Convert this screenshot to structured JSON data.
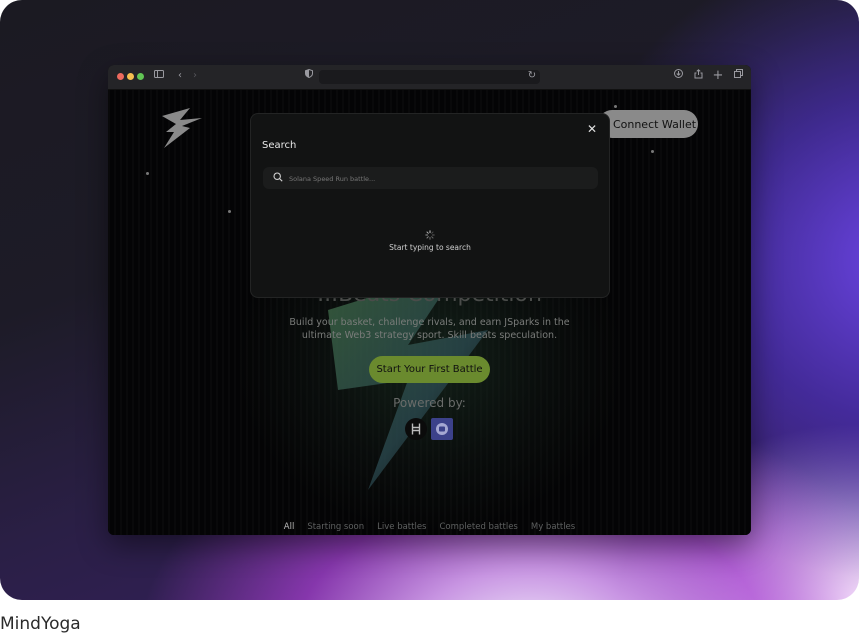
{
  "caption": "MindYoga",
  "browser": {
    "traffic_light_colors": [
      "#ed6a5e",
      "#f5bf4f",
      "#61c554"
    ],
    "icons": [
      "sidebar-icon",
      "back-icon",
      "forward-icon",
      "shield-icon",
      "reload-icon",
      "download-icon",
      "share-icon",
      "new-tab-icon",
      "tabs-icon"
    ]
  },
  "site": {
    "connect_wallet_label": "Connect Wallet",
    "hero_title": "...Beats Competition",
    "hero_subtitle": "Build your basket, challenge rivals, and earn JSparks in the ultimate Web3 strategy sport. Skill beats speculation.",
    "cta_label": "Start Your First Battle",
    "powered_by": "Powered by:",
    "partners": [
      "hedera-logo",
      "partner-logo"
    ],
    "filters": [
      "All",
      "Starting soon",
      "Live battles",
      "Completed battles",
      "My battles"
    ],
    "active_filter": "All",
    "accent_color": "#6a8a2e"
  },
  "search_modal": {
    "title": "Search",
    "placeholder": "Solana Speed Run battle...",
    "value": "",
    "empty_text": "Start typing to search",
    "close_icon": "close-icon"
  }
}
